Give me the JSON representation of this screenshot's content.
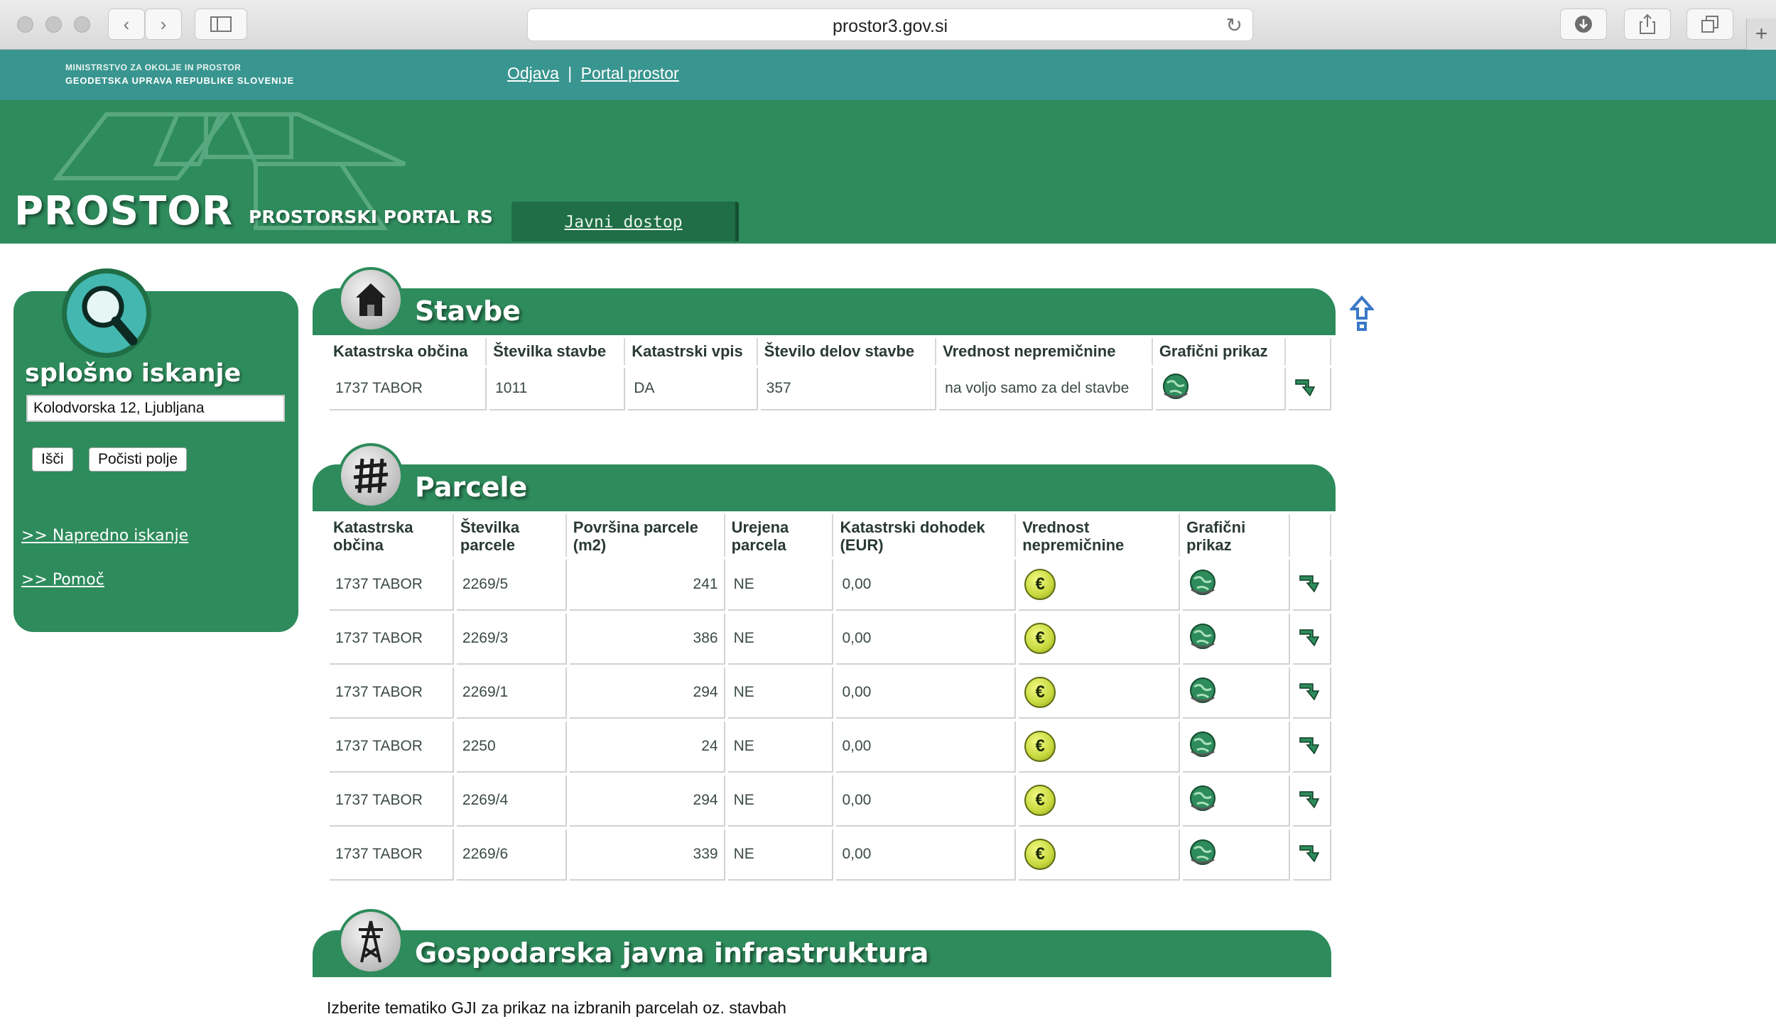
{
  "browser": {
    "url": "prostor3.gov.si"
  },
  "topbar": {
    "ministry_line1": "MINISTRSTVO ZA OKOLJE IN PROSTOR",
    "ministry_line2": "GEODETSKA UPRAVA REPUBLIKE SLOVENIJE",
    "link_odjava": "Odjava",
    "separator": "|",
    "link_portal": "Portal prostor"
  },
  "header": {
    "brand": "PROSTOR",
    "portal_name": "PROSTORSKI PORTAL RS",
    "tab_label": "Javni dostop"
  },
  "search": {
    "title": "splošno iskanje",
    "input_value": "Kolodvorska 12, Ljubljana",
    "search_button": "Išči",
    "clear_button": "Počisti polje",
    "advanced_link": ">> Napredno iskanje",
    "help_link": ">> Pomoč"
  },
  "stavbe": {
    "title": "Stavbe",
    "headers": [
      "Katastrska občina",
      "Številka stavbe",
      "Katastrski vpis",
      "Število delov stavbe",
      "Vrednost nepremičnine",
      "Grafični prikaz"
    ],
    "rows": [
      [
        "1737 TABOR",
        "1011",
        "DA",
        "357",
        "na voljo samo za del stavbe"
      ]
    ]
  },
  "parcele": {
    "title": "Parcele",
    "headers": [
      "Katastrska občina",
      "Številka parcele",
      "Površina parcele (m2)",
      "Urejena parcela",
      "Katastrski dohodek (EUR)",
      "Vrednost nepremičnine",
      "Grafični prikaz"
    ],
    "rows": [
      [
        "1737 TABOR",
        "2269/5",
        "241",
        "NE",
        "0,00"
      ],
      [
        "1737 TABOR",
        "2269/3",
        "386",
        "NE",
        "0,00"
      ],
      [
        "1737 TABOR",
        "2269/1",
        "294",
        "NE",
        "0,00"
      ],
      [
        "1737 TABOR",
        "2250",
        "24",
        "NE",
        "0,00"
      ],
      [
        "1737 TABOR",
        "2269/4",
        "294",
        "NE",
        "0,00"
      ],
      [
        "1737 TABOR",
        "2269/6",
        "339",
        "NE",
        "0,00"
      ]
    ],
    "euro_symbol": "€"
  },
  "gji": {
    "title": "Gospodarska javna infrastruktura",
    "description": "Izberite tematiko GJI za prikaz na izbranih parcelah oz. stavbah"
  },
  "colors": {
    "teal_bar": "#39958f",
    "green": "#2e8b5c",
    "tab_dark": "#1f6e45"
  }
}
